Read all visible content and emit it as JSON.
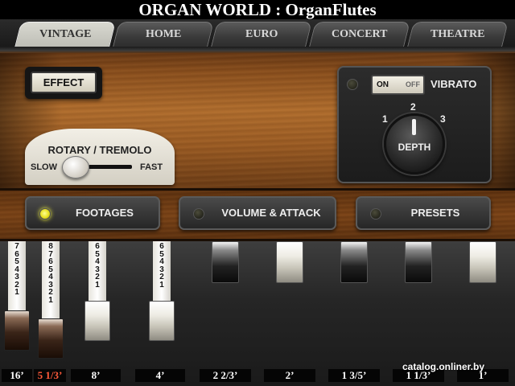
{
  "title": "ORGAN WORLD : OrganFlutes",
  "tabs": [
    {
      "label": "VINTAGE",
      "active": true
    },
    {
      "label": "HOME",
      "active": false
    },
    {
      "label": "EURO",
      "active": false
    },
    {
      "label": "CONCERT",
      "active": false
    },
    {
      "label": "THEATRE",
      "active": false
    }
  ],
  "effect": {
    "label": "EFFECT"
  },
  "rotary": {
    "title": "ROTARY / TREMOLO",
    "slow_label": "SLOW",
    "fast_label": "FAST",
    "setting": "SLOW"
  },
  "vibrato": {
    "on_label": "ON",
    "off_label": "OFF",
    "label": "VIBRATO",
    "state": "ON",
    "depth_label": "DEPTH",
    "depth_scale": [
      "1",
      "2",
      "3"
    ],
    "depth_value": 2
  },
  "nav_buttons": [
    {
      "label": "FOOTAGES",
      "active": true
    },
    {
      "label": "VOLUME & ATTACK",
      "active": false
    },
    {
      "label": "PRESETS",
      "active": false
    }
  ],
  "drawbars": [
    {
      "footage": "16’",
      "scale": [
        "7",
        "6",
        "5",
        "4",
        "3",
        "2",
        "1"
      ],
      "style": "brown",
      "active": false
    },
    {
      "footage": "5 1/3’",
      "scale": [
        "8",
        "7",
        "6",
        "5",
        "4",
        "3",
        "2",
        "1"
      ],
      "style": "brown",
      "active": true
    },
    {
      "footage": "8’",
      "scale": [
        "6",
        "5",
        "4",
        "3",
        "2",
        "1"
      ],
      "style": "white",
      "active": false
    },
    {
      "footage": "4’",
      "scale": [
        "6",
        "5",
        "4",
        "3",
        "2",
        "1"
      ],
      "style": "white",
      "active": false
    },
    {
      "footage": "2 2/3’",
      "scale": [],
      "style": "dark",
      "active": false
    },
    {
      "footage": "2’",
      "scale": [],
      "style": "white",
      "active": false
    },
    {
      "footage": "1 3/5’",
      "scale": [],
      "style": "dark",
      "active": false
    },
    {
      "footage": "1 1/3’",
      "scale": [],
      "style": "dark",
      "active": false
    },
    {
      "footage": "1’",
      "scale": [],
      "style": "white",
      "active": false
    }
  ],
  "colors": {
    "led_on": "#e6e020",
    "active_footage": "#ff5a3a",
    "wood": "#9a5a22"
  },
  "watermark": "catalog.onliner.by"
}
